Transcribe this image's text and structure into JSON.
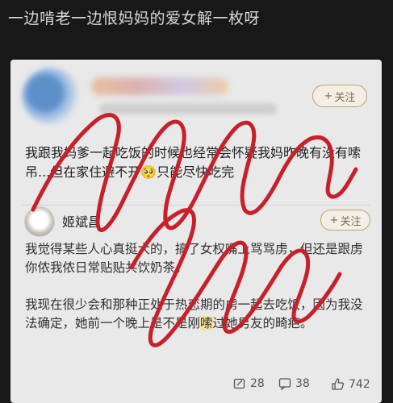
{
  "post": {
    "title": "一边啃老一边恨妈妈的爱女解一枚呀"
  },
  "card": {
    "follow_label": "关注",
    "follow_plus": "+",
    "body_text": "我跟我妈爹一起吃饭的时候也经常会怀疑我妈昨晚有没有嗦吊...但在家住避不开",
    "body_emoji": "🥺",
    "body_tail": "只能尽快吃完"
  },
  "reply": {
    "name": "姬斌昌",
    "follow_label": "关注",
    "follow_plus": "+",
    "paragraph1": "我觉得某些人心真挺大的，搞了女权嘴上骂骂虏，但还是跟虏你侬我侬日常贴贴共饮奶茶。",
    "paragraph2_a": "我现在很少会和那种正处于热恋期的虏一起去吃饭，因为我没法确定，她前一个晚上是不是刚",
    "paragraph2_hl": "嗦",
    "paragraph2_b": "过她男友的畸疤。"
  },
  "footer": {
    "comments": "28",
    "shares": "38",
    "likes": "742"
  },
  "colors": {
    "scribble": "#c8202a",
    "highlight": "#f3e3a3",
    "follow_border": "#bfa36b"
  }
}
